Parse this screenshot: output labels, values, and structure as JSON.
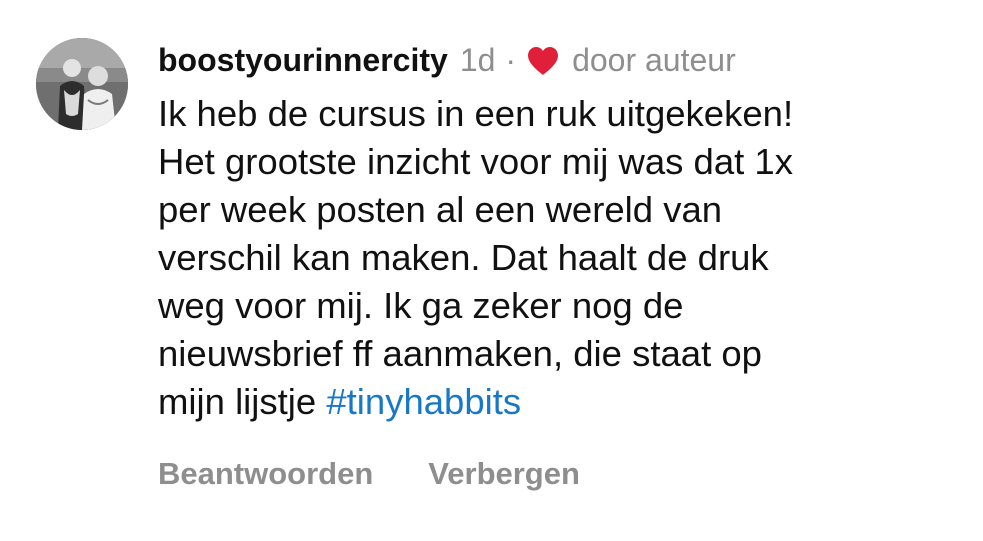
{
  "comment": {
    "username": "boostyourinnercity",
    "time": "1d",
    "separator": "·",
    "liked_by": "door auteur",
    "text": "Ik heb de cursus in een ruk uitgekeken!\nHet grootste inzicht voor mij was dat 1x\nper week posten al een wereld van\nverschil kan maken. Dat haalt de druk\nweg voor mij. Ik ga zeker nog de\nnieuwsbrief ff aanmaken, die staat op\nmijn lijstje ",
    "hashtag": "#tinyhabbits",
    "actions": {
      "reply": "Beantwoorden",
      "hide": "Verbergen"
    }
  },
  "icons": {
    "avatar": "profile-photo",
    "heart": "heart-icon"
  },
  "colors": {
    "text": "#111111",
    "muted": "#8e8e8e",
    "hashtag": "#1877c9",
    "heart": "#e0203a"
  }
}
